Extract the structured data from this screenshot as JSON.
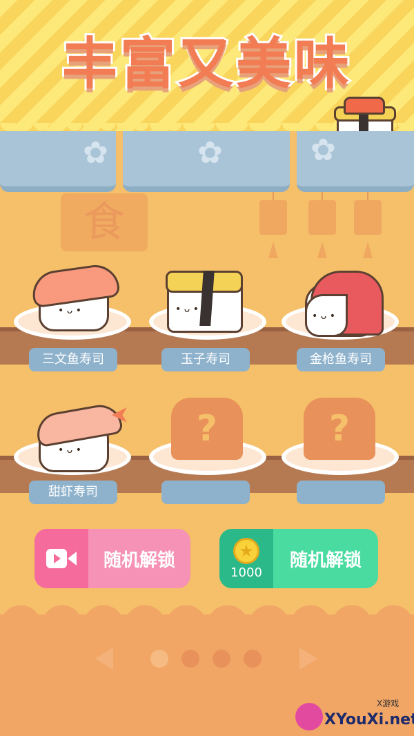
{
  "header": {
    "title": "丰富又美味"
  },
  "decor": {
    "shop_sign": "食"
  },
  "sushi": [
    {
      "name": "三文鱼寿司",
      "topping_color": "#f99a7e",
      "locked": false
    },
    {
      "name": "玉子寿司",
      "topping_color": "#f3d255",
      "locked": false
    },
    {
      "name": "金枪鱼寿司",
      "topping_color": "#e85a5e",
      "locked": false
    },
    {
      "name": "甜虾寿司",
      "topping_color": "#f9b6a0",
      "locked": false
    },
    {
      "name": "",
      "locked": true,
      "symbol": "?"
    },
    {
      "name": "",
      "locked": true,
      "symbol": "?"
    }
  ],
  "buttons": {
    "video_unlock": {
      "label": "随机解锁",
      "color": "#f692b5",
      "icon": "video-camera-icon"
    },
    "coin_unlock": {
      "label": "随机解锁",
      "color": "#4adba1",
      "cost": "1000",
      "icon": "coin-star-icon"
    }
  },
  "pagination": {
    "total": 3,
    "current": 0
  },
  "watermark": {
    "brand": "XYouXi.net",
    "sub": "X游戏"
  }
}
